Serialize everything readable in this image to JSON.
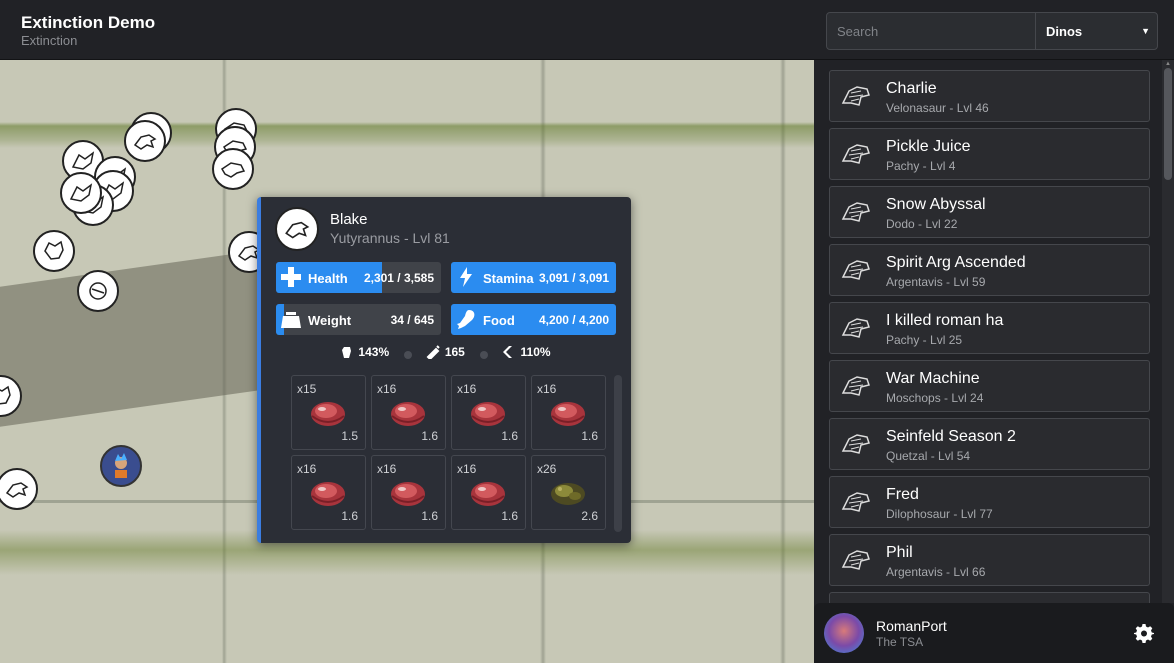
{
  "header": {
    "title": "Extinction Demo",
    "subtitle": "Extinction",
    "search_placeholder": "Search",
    "filter_selected": "Dinos"
  },
  "popup": {
    "name": "Blake",
    "species": "Yutyrannus - Lvl 81",
    "stats": {
      "health": {
        "label": "Health",
        "value": "2,301 / 3,585",
        "fraction": 0.64
      },
      "stamina": {
        "label": "Stamina",
        "value": "3,091 / 3,091",
        "fraction": 1.0
      },
      "weight": {
        "label": "Weight",
        "value": "34 / 645",
        "fraction": 0.05
      },
      "food": {
        "label": "Food",
        "value": "4,200 / 4,200",
        "fraction": 1.0
      }
    },
    "minis": {
      "melee": "143%",
      "torpor": "165",
      "speed": "110%"
    },
    "inventory": [
      {
        "count": "x15",
        "weight": "1.5",
        "item": "raw-meat-icon"
      },
      {
        "count": "x16",
        "weight": "1.6",
        "item": "raw-meat-icon"
      },
      {
        "count": "x16",
        "weight": "1.6",
        "item": "raw-meat-icon"
      },
      {
        "count": "x16",
        "weight": "1.6",
        "item": "raw-meat-icon"
      },
      {
        "count": "x16",
        "weight": "1.6",
        "item": "raw-meat-icon"
      },
      {
        "count": "x16",
        "weight": "1.6",
        "item": "raw-meat-icon"
      },
      {
        "count": "x16",
        "weight": "1.6",
        "item": "raw-meat-icon"
      },
      {
        "count": "x26",
        "weight": "2.6",
        "item": "spoiled-meat-icon"
      }
    ]
  },
  "dinos": [
    {
      "name": "Charlie",
      "sub": "Velonasaur - Lvl 46"
    },
    {
      "name": "Pickle Juice",
      "sub": "Pachy - Lvl 4"
    },
    {
      "name": "Snow Abyssal",
      "sub": "Dodo - Lvl 22"
    },
    {
      "name": "Spirit Arg Ascended",
      "sub": "Argentavis - Lvl 59"
    },
    {
      "name": "I killed roman ha",
      "sub": "Pachy - Lvl 25"
    },
    {
      "name": "War Machine",
      "sub": "Moschops - Lvl 24"
    },
    {
      "name": "Seinfeld Season 2",
      "sub": "Quetzal - Lvl 54"
    },
    {
      "name": "Fred",
      "sub": "Dilophosaur - Lvl 77"
    },
    {
      "name": "Phil",
      "sub": "Argentavis - Lvl 66"
    }
  ],
  "user": {
    "name": "RomanPort",
    "tribe": "The TSA"
  },
  "colors": {
    "accent": "#2b8cf0",
    "popup_border": "#3b7de0",
    "background": "#212226"
  }
}
